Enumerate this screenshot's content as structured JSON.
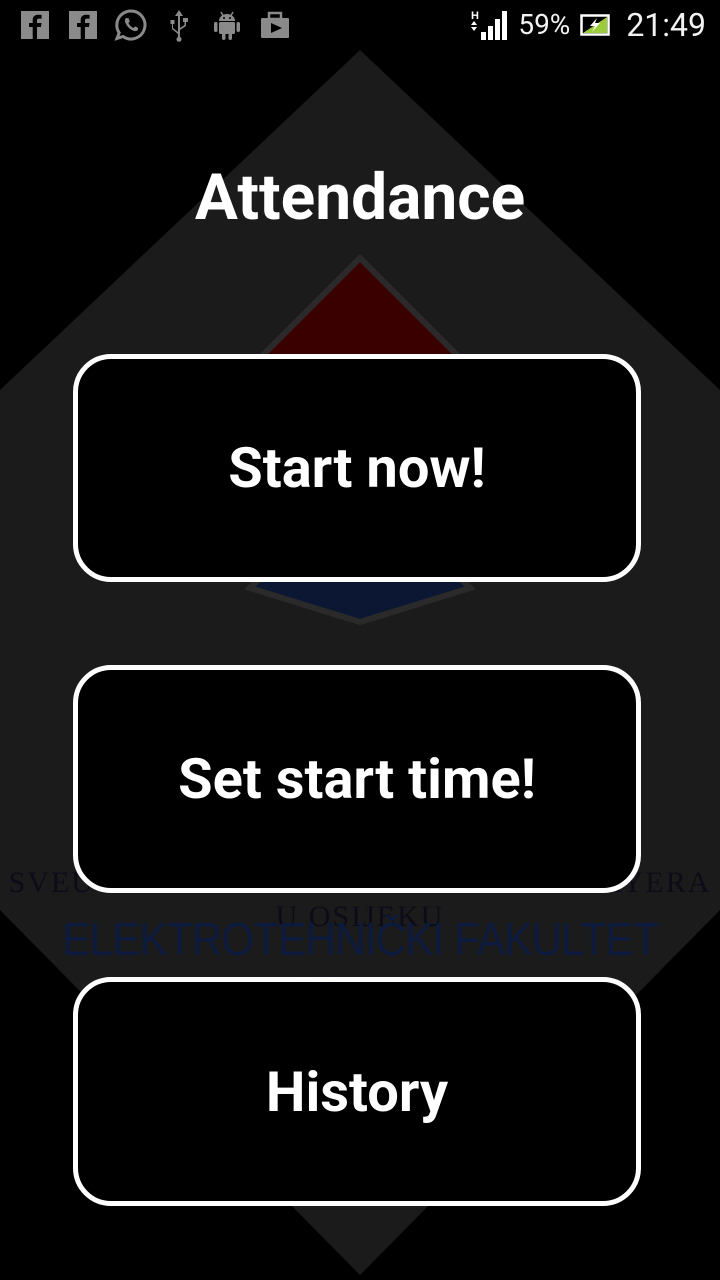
{
  "status_bar": {
    "icons": [
      "facebook-icon",
      "facebook-icon",
      "whatsapp-icon",
      "usb-icon",
      "android-icon",
      "briefcase-icon"
    ],
    "network": "H",
    "battery_percent": "59%",
    "time": "21:49"
  },
  "background": {
    "institution_subtitle": "SVEUČILIŠTE JOSIPA JURJA STROSSMAYERA U OSIJEKU",
    "institution_name": "ELEKTROTEHNIČKI FAKULTET OSIJEK",
    "colors": {
      "hexagon": "#1c1c1c",
      "diamond_red": "#3a0000",
      "diamond_blue": "#0a1a38"
    }
  },
  "app": {
    "title": "Attendance",
    "buttons": {
      "start_now": "Start now!",
      "set_start_time": "Set start time!",
      "history": "History"
    }
  }
}
